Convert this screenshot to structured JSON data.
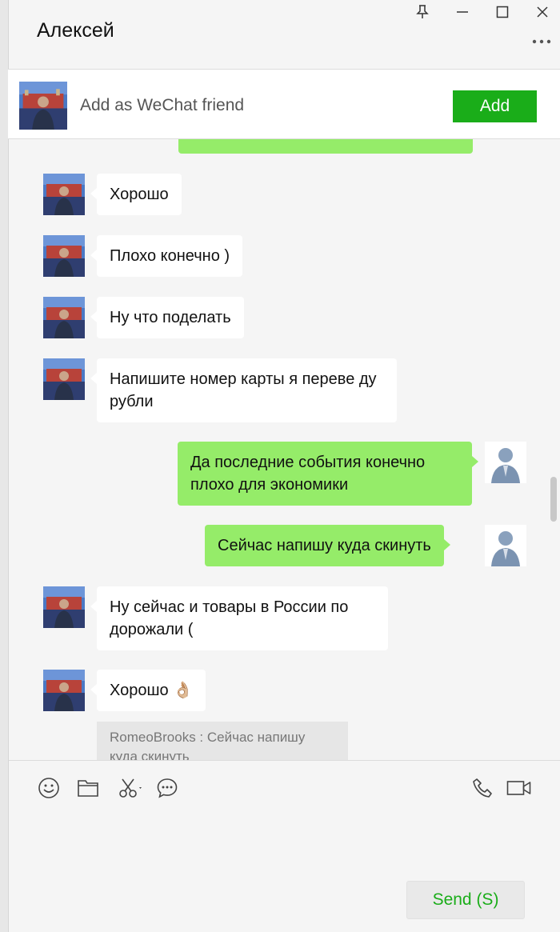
{
  "window": {
    "title": "Алексей",
    "controls": [
      "pin-icon",
      "minimize-icon",
      "maximize-icon",
      "close-icon"
    ]
  },
  "banner": {
    "text": "Add as WeChat friend",
    "add_label": "Add"
  },
  "messages": [
    {
      "side": "in",
      "text": "Хорошо"
    },
    {
      "side": "in",
      "text": "Плохо конечно )"
    },
    {
      "side": "in",
      "text": "Ну что поделать"
    },
    {
      "side": "in",
      "text": "Напишите номер карты я переве ду рубли"
    },
    {
      "side": "out",
      "text": "Да последние события конечно плохо для экономики"
    },
    {
      "side": "out",
      "text": "Сейчас напишу куда скинуть"
    },
    {
      "side": "in",
      "text": "Ну сейчас и товары в России по дорожали ("
    },
    {
      "side": "in",
      "text": "Хорошо 👌🏼"
    }
  ],
  "quote": {
    "text": "RomeoBrooks : Сейчас напишу куда скинуть"
  },
  "toolbar": {
    "left_icons": [
      "emoji-icon",
      "folder-icon",
      "scissors-icon",
      "chat-history-icon"
    ],
    "right_icons": [
      "phone-icon",
      "video-call-icon"
    ]
  },
  "input": {
    "value": ""
  },
  "send": {
    "label": "Send (S)"
  },
  "colors": {
    "accent": "#1aad19",
    "outgoing_bubble": "#95ec69",
    "incoming_bubble": "#ffffff",
    "background": "#f5f5f5"
  }
}
